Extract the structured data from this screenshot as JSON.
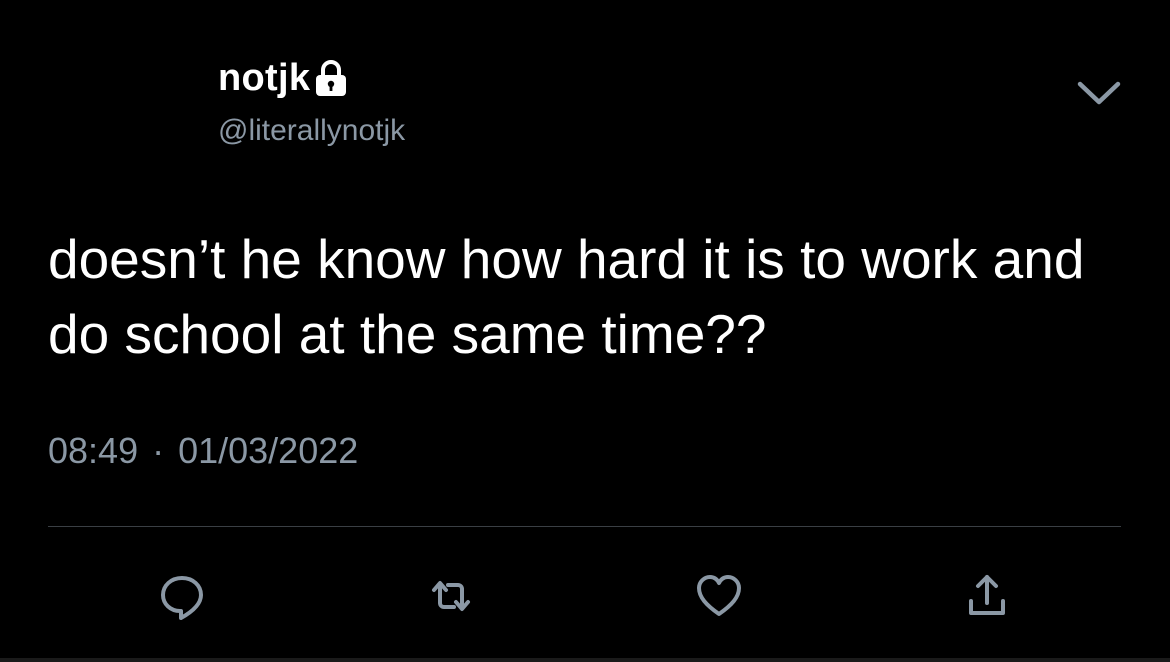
{
  "user": {
    "display_name": "notjk",
    "handle": "@literallynotjk",
    "protected_icon": "lock-icon"
  },
  "menu": {
    "icon": "chevron-down-icon"
  },
  "tweet": {
    "text": "doesn’t he know how hard it is to work and do school at the same time??",
    "time": "08:49",
    "separator": "·",
    "date": "01/03/2022"
  },
  "actions": [
    {
      "icon": "reply-icon"
    },
    {
      "icon": "retweet-icon"
    },
    {
      "icon": "like-icon"
    },
    {
      "icon": "share-icon"
    }
  ],
  "colors": {
    "background": "#000000",
    "primary_text": "#ffffff",
    "secondary_text": "#8b98a5",
    "icon": "#8b98a5",
    "divider": "#3a3f44"
  }
}
